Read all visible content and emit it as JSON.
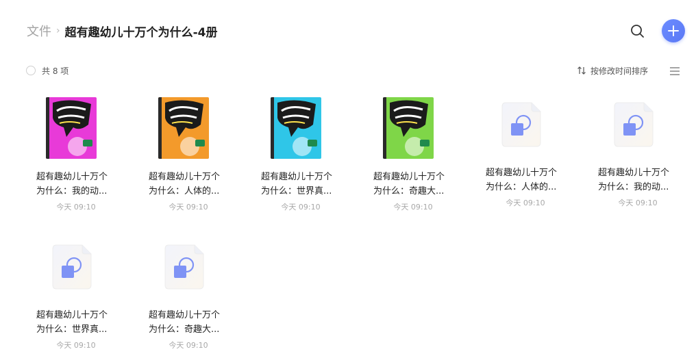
{
  "breadcrumb": {
    "root": "文件",
    "separator": "›",
    "current": "超有趣幼儿十万个为什么-4册"
  },
  "toolbar": {
    "count_label": "共 8 项",
    "sort_label": "按修改时间排序"
  },
  "colors": {
    "accent": "#5a78f5",
    "cover_magenta": "#e83ad8",
    "cover_orange": "#f39a2b",
    "cover_cyan": "#2fc6e8",
    "cover_green": "#7fd648"
  },
  "items": [
    {
      "line1": "超有趣幼儿十万个",
      "line2": "为什么：我的动...",
      "time": "今天 09:10",
      "type": "cover",
      "color": "#e83ad8"
    },
    {
      "line1": "超有趣幼儿十万个",
      "line2": "为什么：人体的...",
      "time": "今天 09:10",
      "type": "cover",
      "color": "#f39a2b"
    },
    {
      "line1": "超有趣幼儿十万个",
      "line2": "为什么：世界真...",
      "time": "今天 09:10",
      "type": "cover",
      "color": "#2fc6e8"
    },
    {
      "line1": "超有趣幼儿十万个",
      "line2": "为什么：奇趣大...",
      "time": "今天 09:10",
      "type": "cover",
      "color": "#7fd648"
    },
    {
      "line1": "超有趣幼儿十万个",
      "line2": "为什么：人体的...",
      "time": "今天 09:10",
      "type": "doc"
    },
    {
      "line1": "超有趣幼儿十万个",
      "line2": "为什么：我的动...",
      "time": "今天 09:10",
      "type": "doc"
    },
    {
      "line1": "超有趣幼儿十万个",
      "line2": "为什么：世界真...",
      "time": "今天 09:10",
      "type": "doc"
    },
    {
      "line1": "超有趣幼儿十万个",
      "line2": "为什么：奇趣大...",
      "time": "今天 09:10",
      "type": "doc"
    }
  ]
}
